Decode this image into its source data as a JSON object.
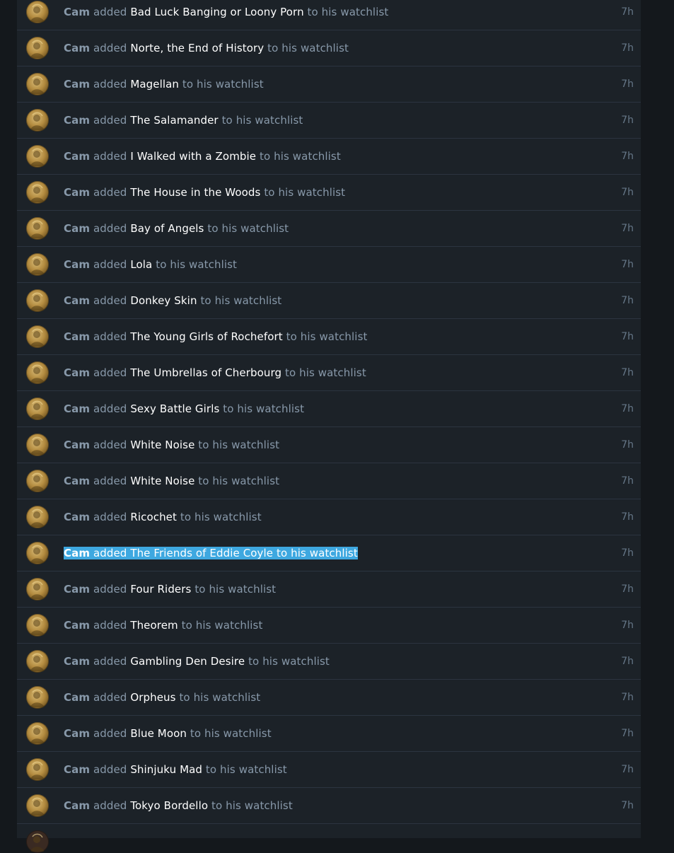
{
  "activity": {
    "items": [
      {
        "user": "Cam",
        "verb": "added",
        "film": "Bad Luck Banging or Loony Porn",
        "suffix": "to his watchlist",
        "time": "7h"
      },
      {
        "user": "Cam",
        "verb": "added",
        "film": "Norte, the End of History",
        "suffix": "to his watchlist",
        "time": "7h"
      },
      {
        "user": "Cam",
        "verb": "added",
        "film": "Magellan",
        "suffix": "to his watchlist",
        "time": "7h"
      },
      {
        "user": "Cam",
        "verb": "added",
        "film": "The Salamander",
        "suffix": "to his watchlist",
        "time": "7h"
      },
      {
        "user": "Cam",
        "verb": "added",
        "film": "I Walked with a Zombie",
        "suffix": "to his watchlist",
        "time": "7h"
      },
      {
        "user": "Cam",
        "verb": "added",
        "film": "The House in the Woods",
        "suffix": "to his watchlist",
        "time": "7h"
      },
      {
        "user": "Cam",
        "verb": "added",
        "film": "Bay of Angels",
        "suffix": "to his watchlist",
        "time": "7h"
      },
      {
        "user": "Cam",
        "verb": "added",
        "film": "Lola",
        "suffix": "to his watchlist",
        "time": "7h"
      },
      {
        "user": "Cam",
        "verb": "added",
        "film": "Donkey Skin",
        "suffix": "to his watchlist",
        "time": "7h"
      },
      {
        "user": "Cam",
        "verb": "added",
        "film": "The Young Girls of Rochefort",
        "suffix": "to his watchlist",
        "time": "7h"
      },
      {
        "user": "Cam",
        "verb": "added",
        "film": "The Umbrellas of Cherbourg",
        "suffix": "to his watchlist",
        "time": "7h"
      },
      {
        "user": "Cam",
        "verb": "added",
        "film": "Sexy Battle Girls",
        "suffix": "to his watchlist",
        "time": "7h"
      },
      {
        "user": "Cam",
        "verb": "added",
        "film": "White Noise",
        "suffix": "to his watchlist",
        "time": "7h"
      },
      {
        "user": "Cam",
        "verb": "added",
        "film": "White Noise",
        "suffix": "to his watchlist",
        "time": "7h"
      },
      {
        "user": "Cam",
        "verb": "added",
        "film": "Ricochet",
        "suffix": "to his watchlist",
        "time": "7h"
      },
      {
        "user": "Cam",
        "verb": "added",
        "film": "The Friends of Eddie Coyle",
        "suffix": "to his watchlist",
        "time": "7h"
      },
      {
        "user": "Cam",
        "verb": "added",
        "film": "Four Riders",
        "suffix": "to his watchlist",
        "time": "7h"
      },
      {
        "user": "Cam",
        "verb": "added",
        "film": "Theorem",
        "suffix": "to his watchlist",
        "time": "7h"
      },
      {
        "user": "Cam",
        "verb": "added",
        "film": "Gambling Den Desire",
        "suffix": "to his watchlist",
        "time": "7h"
      },
      {
        "user": "Cam",
        "verb": "added",
        "film": "Orpheus",
        "suffix": "to his watchlist",
        "time": "7h"
      },
      {
        "user": "Cam",
        "verb": "added",
        "film": "Blue Moon",
        "suffix": "to his watchlist",
        "time": "7h"
      },
      {
        "user": "Cam",
        "verb": "added",
        "film": "Shinjuku Mad",
        "suffix": "to his watchlist",
        "time": "7h"
      },
      {
        "user": "Cam",
        "verb": "added",
        "film": "Tokyo Bordello",
        "suffix": "to his watchlist",
        "time": "7h"
      }
    ],
    "selected_index": 15
  },
  "colors": {
    "page_bg": "#14181c",
    "row_bg": "#1c2228",
    "row_border": "#2c3440",
    "muted_text": "#8899aa",
    "film_text": "#ffffff",
    "selection": "#3ea8e0"
  }
}
